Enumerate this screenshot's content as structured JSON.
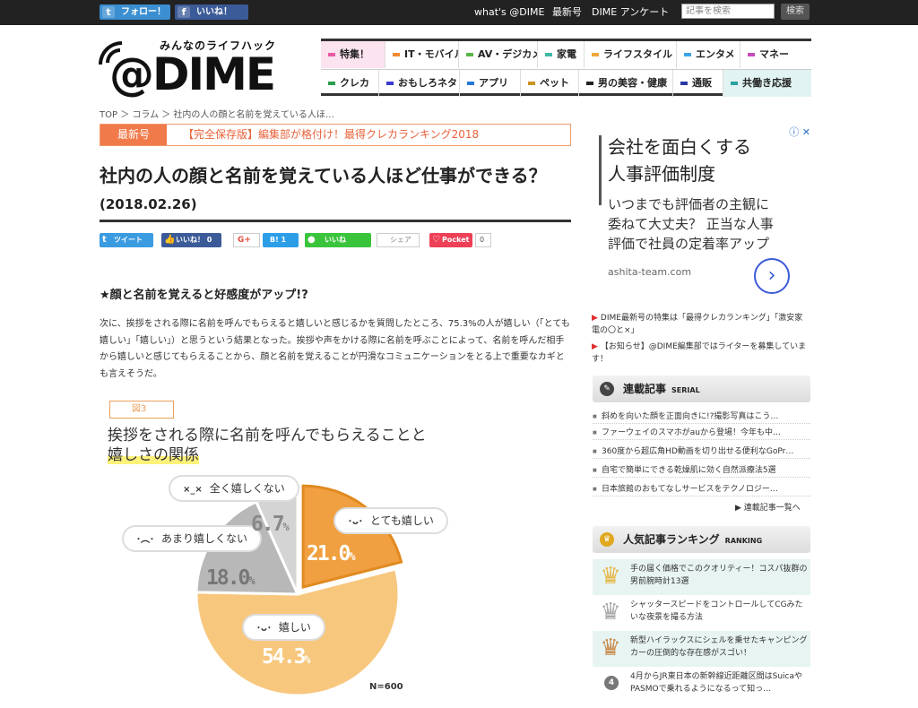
{
  "topbar": {
    "twitter_label": "フォロー！",
    "facebook_label": "いいね！",
    "links": [
      "what's @DIME",
      "最新号",
      "DIME アンケート"
    ],
    "search_placeholder": "記事を検索",
    "search_button": "検索"
  },
  "logo": {
    "tagline": "みんなのライフハック",
    "name": "@DIME"
  },
  "nav": {
    "row1": [
      {
        "label": "特集！",
        "color": "#e85aa3"
      },
      {
        "label": "IT・モバイル",
        "color": "#f08a2e"
      },
      {
        "label": "AV・デジカメ",
        "color": "#5ab548"
      },
      {
        "label": "家電",
        "color": "#3fb8a8"
      },
      {
        "label": "ライフスタイル",
        "color": "#f0a83a"
      },
      {
        "label": "エンタメ",
        "color": "#3aa5e8"
      },
      {
        "label": "マネー",
        "color": "#c54bbf"
      }
    ],
    "row2": [
      {
        "label": "クレカ",
        "color": "#2a9d4a"
      },
      {
        "label": "おもしろネタ",
        "color": "#3a3ad0"
      },
      {
        "label": "アプリ",
        "color": "#2878d8"
      },
      {
        "label": "ペット",
        "color": "#c99420"
      },
      {
        "label": "男の美容・健康",
        "color": "#222222"
      },
      {
        "label": "通販",
        "color": "#2a3aa0"
      },
      {
        "label": "共働き応援",
        "color": "#2aa0a0"
      }
    ]
  },
  "breadcrumb": "TOP ＞ コラム ＞ 社内の人の顔と名前を覚えている人ほ…",
  "latest": {
    "label": "最新号",
    "text": "【完全保存版】編集部が格付け！最得クレカランキング2018"
  },
  "article": {
    "title": "社内の人の顔と名前を覚えている人ほど仕事ができる？",
    "date": "(2018.02.26)",
    "subhead": "★顔と名前を覚えると好感度がアップ!?",
    "body": "次に、挨拶をされる際に名前を呼んでもらえると嬉しいと感じるかを質問したところ、75.3%の人が嬉しい（「とても嬉しい」「嬉しい」）と思うという結果となった。挨拶や声をかける際に名前を呼ぶことによって、名前を呼んだ相手から嬉しいと感じてもらえることから、顔と名前を覚えることが円滑なコミュニケーションをとる上で重要なカギとも言えそうだ。"
  },
  "share": {
    "tweet": "ツイート",
    "like": "いいね！",
    "like_count": "0",
    "hatena": "B! 1",
    "line": "いいね",
    "share": "シェア",
    "pocket": "Pocket",
    "pocket_count": "0"
  },
  "figure": {
    "label": "図3",
    "title_line1": "挨拶をされる際に名前を呼んでもらえることと",
    "title_line2": "嬉しさの関係",
    "n": "N=600"
  },
  "chart_data": {
    "type": "pie",
    "title": "挨拶をされる際に名前を呼んでもらえることと嬉しさの関係",
    "n": "N=600",
    "slices": [
      {
        "label": "とても嬉しい",
        "value": 21.0,
        "display": "21.0",
        "color": "#f0a040",
        "face": "･ᴗ･"
      },
      {
        "label": "嬉しい",
        "value": 54.3,
        "display": "54.3",
        "color": "#f7c77d",
        "face": "･ᴗ･"
      },
      {
        "label": "あまり嬉しくない",
        "value": 18.0,
        "display": "18.0",
        "color": "#b8b8b8",
        "face": "･︵･"
      },
      {
        "label": "全く嬉しくない",
        "value": 6.7,
        "display": "6.7",
        "color": "#d4d4d4",
        "face": "×_×"
      }
    ]
  },
  "ad": {
    "title_line1": "会社を面白くする",
    "title_line2": "人事評価制度",
    "desc_line1": "いつまでも評価者の主観に",
    "desc_line2": "委ねて大丈夫？ 正当な人事",
    "desc_line3": "評価で社員の定着率アップ",
    "url": "ashita-team.com"
  },
  "notices": [
    "DIME最新号の特集は「最得クレカランキング」「激安家電の〇と×」",
    "【お知らせ】@DIME編集部ではライターを募集しています！"
  ],
  "serial": {
    "title": "連載記事",
    "title_en": "SERIAL",
    "items": [
      "斜めを向いた顔を正面向きに!?撮影写真はこう…",
      "ファーウェイのスマホがauから登場！今年も中…",
      "360度から超広角HD動画を切り出せる便利なGoPr…",
      "自宅で簡単にできる乾燥肌に効く自然派療法5選",
      "日本旅館のおもてなしサービスをテクノロジー…"
    ],
    "more": "連載記事一覧へ"
  },
  "ranking": {
    "title": "人気記事ランキング",
    "title_en": "RANKING",
    "items": [
      {
        "rank": "1",
        "text": "手の届く価格でこのクオリティー！コスパ抜群の男前腕時計13選"
      },
      {
        "rank": "2",
        "text": "シャッタースピードをコントロールしてCGみたいな夜景を撮る方法"
      },
      {
        "rank": "3",
        "text": "新型ハイラックスにシェルを乗せたキャンピングカーの圧倒的な存在感がスゴい！"
      },
      {
        "rank": "4",
        "text": "4月からJR東日本の新幹線近距離区間はSuicaやPASMOで乗れるようになるって知っ…"
      }
    ]
  }
}
